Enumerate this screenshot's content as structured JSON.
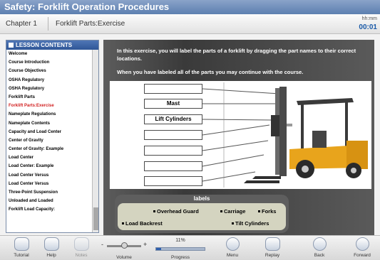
{
  "window": {
    "title": "Safety: Forklift Operation Procedures"
  },
  "breadcrumb": {
    "chapter": "Chapter 1",
    "page": "Forklift Parts:Exercise"
  },
  "timer": {
    "format": "hh:mm",
    "value": "00:01"
  },
  "sidebar": {
    "title": "LESSON CONTENTS",
    "items": [
      "Welcome",
      "Course Introduction",
      "Course Objectives",
      "OSHA Regulatory",
      "OSHA Regulatory",
      "Forklift Parts",
      "Forklift Parts:Exercise",
      "Nameplate Regulations",
      "Nameplate Contents",
      "Capacity and Load Center",
      "Center of Gravity",
      "Center of Gravity: Example",
      "Load Center",
      "Load Center: Example",
      "Load Center Versus",
      "Load Center Versus",
      "Three-Point Suspension",
      "Unloaded and Loaded",
      "Forklift Load Capacity:"
    ],
    "active_index": 6
  },
  "instructions": {
    "line1": "In this exercise, you will label the parts of a forklift by dragging the part names to their correct locations.",
    "line2": "When you have labeled all of the parts you may continue with the course."
  },
  "slots": [
    "",
    "Mast",
    "Lift Cylinders",
    "",
    "",
    "",
    ""
  ],
  "labels_panel": {
    "title": "labels",
    "items": [
      "Overhead Guard",
      "Carriage",
      "Forks",
      "Load Backrest",
      "Tilt Cylinders"
    ]
  },
  "toolbar": {
    "tutorial": "Tutorial",
    "help": "Help",
    "notes": "Notes",
    "volume": "Volume",
    "volume_minus": "-",
    "volume_plus": "+",
    "progress": "Progress",
    "progress_pct": "11%",
    "progress_value": 0.11,
    "menu": "Menu",
    "replay": "Replay",
    "back": "Back",
    "forward": "Forward"
  },
  "colors": {
    "title_bar": "#5c7fb0",
    "active_item": "#d11f1f",
    "forklift": "#e8a41c"
  }
}
